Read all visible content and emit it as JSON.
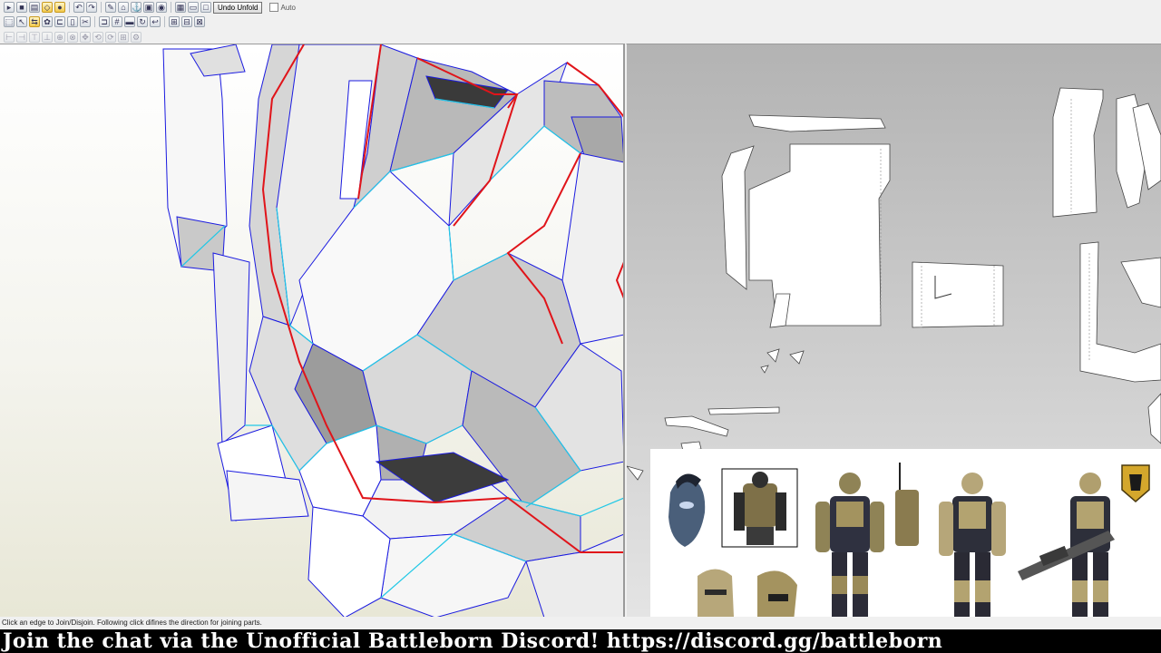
{
  "toolbar": {
    "undo_unfold_label": "Undo Unfold",
    "auto_label": "Auto"
  },
  "status_bar": {
    "message": "Click an edge to Join/Disjoin. Following click difines the direction for joining parts."
  },
  "stream_banner": {
    "text": "Join the chat via the Unofficial Battleborn Discord! https://discord.gg/battleborn"
  },
  "colors": {
    "cut_edge": "#e0141a",
    "fold_edge": "#21c8e6",
    "mesh_line": "#1a1ae0",
    "banner_bg": "#000000"
  },
  "icons": [
    "open-icon",
    "save-icon",
    "print-icon",
    "select-icon",
    "undo-icon",
    "redo-icon",
    "edit-icon",
    "unfold-icon",
    "join-icon",
    "move-icon",
    "rotate-icon",
    "flap-icon",
    "zoom-icon",
    "fit-icon",
    "page-icon"
  ]
}
